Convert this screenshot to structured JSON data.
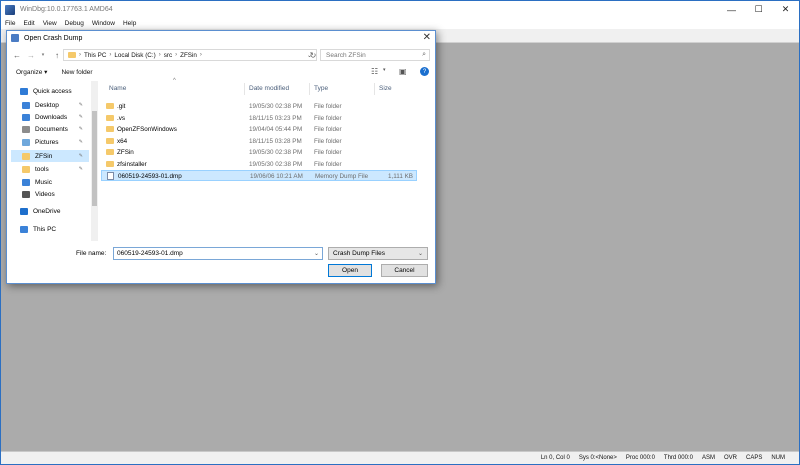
{
  "app": {
    "title": "WinDbg:10.0.17763.1 AMD64",
    "window_controls": [
      "—",
      "☐",
      "✕"
    ]
  },
  "menu": [
    "File",
    "Edit",
    "View",
    "Debug",
    "Window",
    "Help"
  ],
  "status": [
    "Ln 0, Col 0",
    "Sys 0:<None>",
    "Proc 000:0",
    "Thrd 000:0",
    "ASM",
    "OVR",
    "CAPS",
    "NUM"
  ],
  "dialog": {
    "title": "Open Crash Dump",
    "close": "✕",
    "breadcrumb": [
      "This PC",
      "Local Disk (C:)",
      "src",
      "ZFSin"
    ],
    "search_placeholder": "Search ZFSin",
    "organize": "Organize ▾",
    "new_folder": "New folder",
    "help": "?",
    "nav": [
      {
        "label": "Quick access",
        "icon": "star-icon",
        "color": "#2f7bd6"
      },
      {
        "label": "Desktop",
        "icon": "desktop-icon",
        "color": "#3b82d8",
        "pinned": true
      },
      {
        "label": "Downloads",
        "icon": "downloads-icon",
        "color": "#3b82d8",
        "pinned": true
      },
      {
        "label": "Documents",
        "icon": "documents-icon",
        "color": "#8c8c8c",
        "pinned": true
      },
      {
        "label": "Pictures",
        "icon": "pictures-icon",
        "color": "#6fa8dc",
        "pinned": true
      },
      {
        "label": "ZFSin",
        "icon": "folder-icon",
        "color": "#f5c96a",
        "pinned": true,
        "selected": true
      },
      {
        "label": "tools",
        "icon": "folder-icon",
        "color": "#f5c96a",
        "pinned": true
      },
      {
        "label": "Music",
        "icon": "music-icon",
        "color": "#3b82d8"
      },
      {
        "label": "Videos",
        "icon": "videos-icon",
        "color": "#555555"
      },
      {
        "label": "OneDrive",
        "icon": "onedrive-icon",
        "color": "#1e6fcc"
      },
      {
        "label": "This PC",
        "icon": "pc-icon",
        "color": "#3b82d8"
      }
    ],
    "columns": [
      "Name",
      "Date modified",
      "Type",
      "Size"
    ],
    "files": [
      {
        "name": ".git",
        "date": "19/05/30 02:38 PM",
        "type": "File folder",
        "size": "",
        "kind": "folder"
      },
      {
        "name": ".vs",
        "date": "18/11/15 03:23 PM",
        "type": "File folder",
        "size": "",
        "kind": "folder"
      },
      {
        "name": "OpenZFSonWindows",
        "date": "19/04/04 05:44 PM",
        "type": "File folder",
        "size": "",
        "kind": "folder"
      },
      {
        "name": "x64",
        "date": "18/11/15 03:28 PM",
        "type": "File folder",
        "size": "",
        "kind": "folder"
      },
      {
        "name": "ZFSin",
        "date": "19/05/30 02:38 PM",
        "type": "File folder",
        "size": "",
        "kind": "folder"
      },
      {
        "name": "zfsinstaller",
        "date": "19/05/30 02:38 PM",
        "type": "File folder",
        "size": "",
        "kind": "folder"
      },
      {
        "name": "060519-24593-01.dmp",
        "date": "19/06/06 10:21 AM",
        "type": "Memory Dump File",
        "size": "1,111 KB",
        "kind": "dump",
        "selected": true
      }
    ],
    "file_name_label": "File name:",
    "file_name_value": "060519-24593-01.dmp",
    "file_type": "Crash Dump Files",
    "open_label": "Open",
    "cancel_label": "Cancel"
  }
}
